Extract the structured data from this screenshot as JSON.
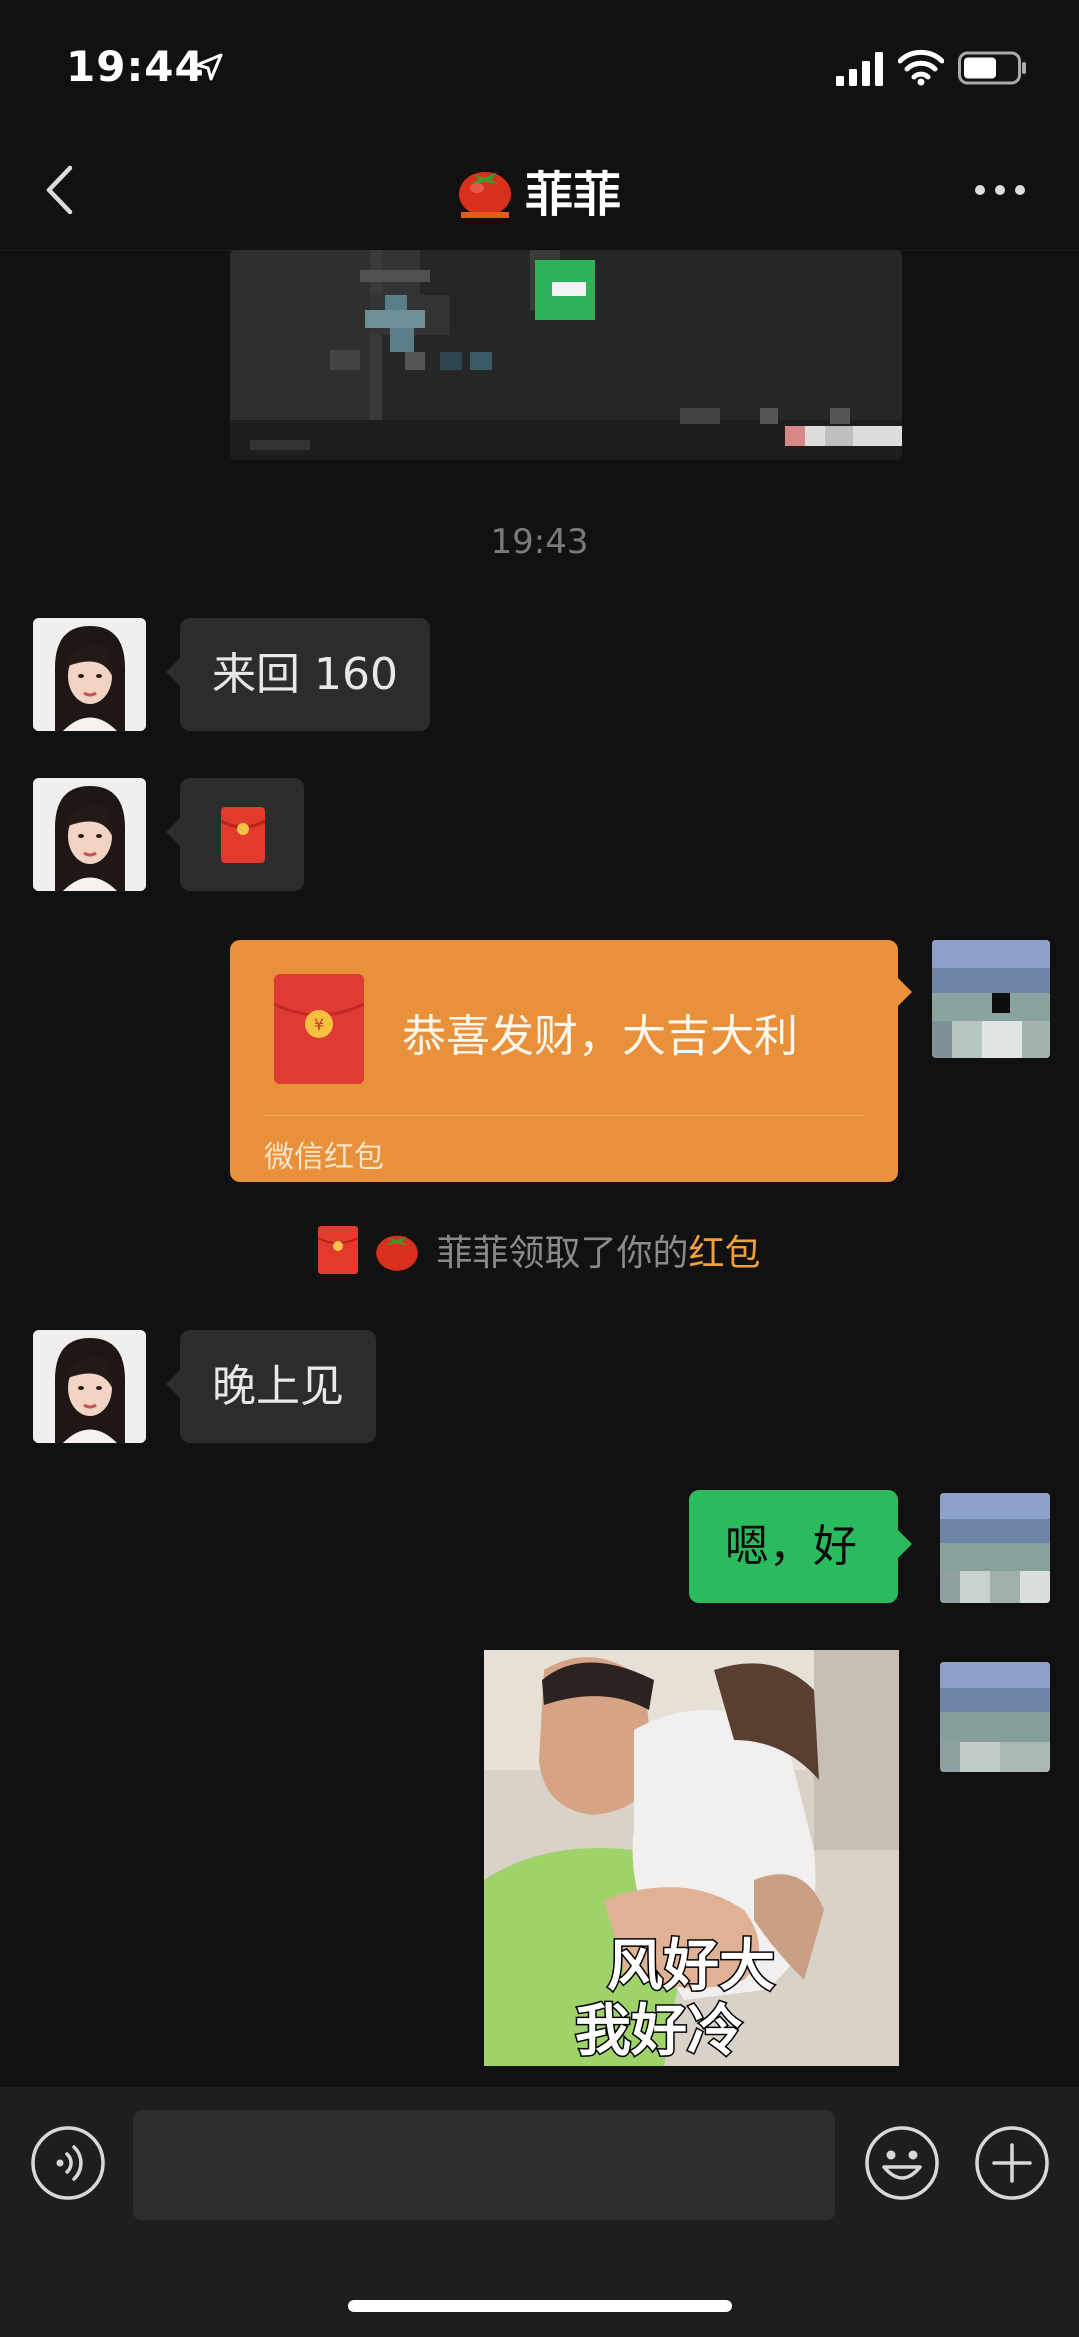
{
  "status_bar": {
    "time": "19:44",
    "icons": [
      "location-arrow-icon",
      "signal-icon",
      "wifi-icon",
      "battery-icon"
    ]
  },
  "header": {
    "title": "菲菲",
    "title_emoji": "tomato-icon",
    "back_icon": "chevron-left-icon",
    "more_icon": "ellipsis-icon"
  },
  "messages": {
    "timestamp": "19:43",
    "msg1": "来回 160",
    "msg3": "晚上见",
    "msg4": "嗯，好",
    "red_packet": {
      "wish": "恭喜发财，大吉大利",
      "footer": "微信红包"
    },
    "notice": {
      "prefix": "菲菲领取了你的",
      "highlight": "红包"
    },
    "meme_caption_line1": "风好大",
    "meme_caption_line2": "我好冷"
  },
  "input_bar": {
    "value": "",
    "icons": [
      "voice-icon",
      "emoji-icon",
      "plus-icon"
    ]
  },
  "colors": {
    "background": "#111111",
    "bubble_incoming": "#2c2c2c",
    "bubble_outgoing": "#2bbb5e",
    "red_packet": "#e8913a",
    "red_packet_highlight": "#f0a03c"
  }
}
